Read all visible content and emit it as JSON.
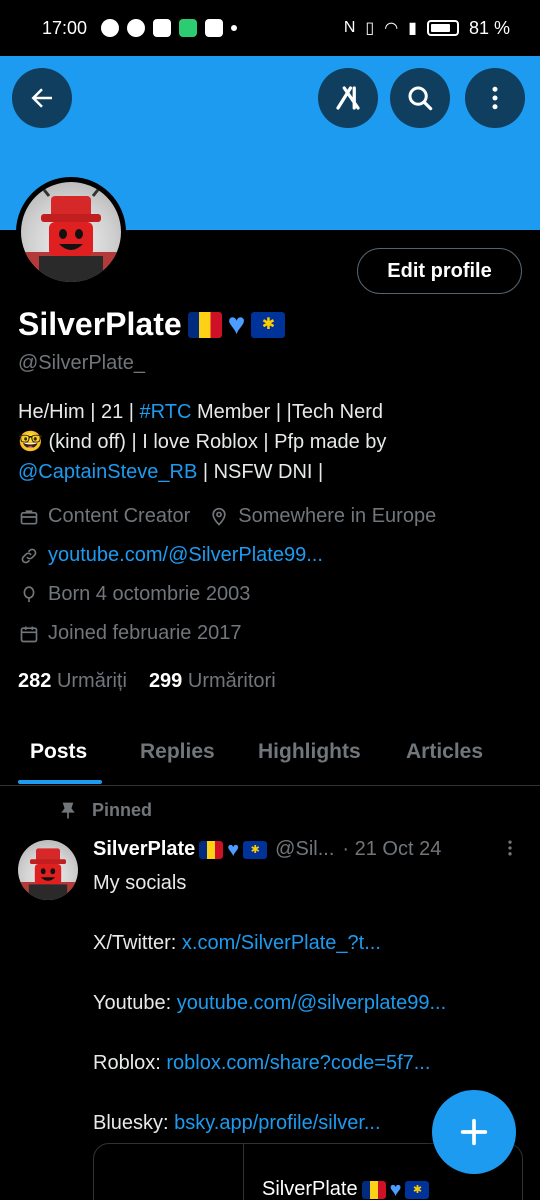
{
  "status_bar": {
    "time": "17:00",
    "battery_text": "81 %",
    "battery_level": 0.81
  },
  "colors": {
    "banner": "#1d9bf0",
    "accent": "#1d9bf0",
    "background": "#000000"
  },
  "header": {
    "back_icon": "arrow-left-icon",
    "grok_icon": "grok-icon",
    "search_icon": "search-icon",
    "more_icon": "more-vertical-icon"
  },
  "profile": {
    "edit_label": "Edit profile",
    "name": "SilverPlate",
    "handle": "@SilverPlate_",
    "bio": {
      "p1": "He/Him | 21 | ",
      "hashtag": "#RTC",
      "p2": " Member | |Tech Nerd",
      "p3": " (kind off) | I love Roblox | Pfp made by",
      "mention": "@CaptainSteve_RB",
      "p4": " | NSFW DNI |"
    },
    "category": "Content Creator",
    "location": "Somewhere in Europe",
    "website": "youtube.com/@SilverPlate99...",
    "born": "Born 4 octombrie 2003",
    "joined": "Joined februarie 2017",
    "following_count": "282",
    "following_label": "Urmăriți",
    "followers_count": "299",
    "followers_label": "Urmăritori"
  },
  "tabs": [
    "Posts",
    "Replies",
    "Highlights",
    "Articles"
  ],
  "post": {
    "pinned_label": "Pinned",
    "author": "SilverPlate",
    "handle": "@Sil...",
    "date": "· 21 Oct 24",
    "lines": {
      "l1": "My socials",
      "twitter_label": "X/Twitter: ",
      "twitter_link": "x.com/SilverPlate_?t...",
      "youtube_label": "Youtube: ",
      "youtube_link": "youtube.com/@silverplate99...",
      "roblox_label": "Roblox: ",
      "roblox_link": "roblox.com/share?code=5f7...",
      "bluesky_label": "Bluesky: ",
      "bluesky_link": "bsky.app/profile/silver..."
    },
    "quote_name": "SilverPlate"
  },
  "fab_icon": "plus-icon"
}
